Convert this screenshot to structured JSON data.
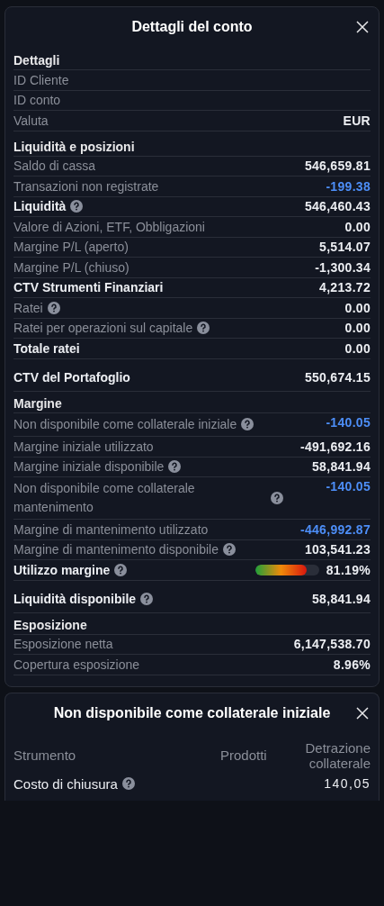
{
  "account_panel": {
    "title": "Dettagli del conto",
    "groups": [
      {
        "title": "Dettagli",
        "rows": [
          {
            "kind": "detail",
            "label": "ID Cliente",
            "help": false
          },
          {
            "kind": "detail",
            "label": "ID conto",
            "help": false
          },
          {
            "kind": "detail",
            "label": "Valuta",
            "value": "EUR",
            "help": false,
            "accent": false
          }
        ]
      },
      {
        "title": "Liquidità e posizioni",
        "rows": [
          {
            "kind": "detail",
            "label": "Saldo di cassa",
            "value": "546,659.81",
            "help": false,
            "accent": false
          },
          {
            "kind": "detail",
            "label": "Transazioni non registrate",
            "value": "-199.38",
            "help": false,
            "accent": true
          },
          {
            "kind": "total",
            "label": "Liquidità",
            "value": "546,460.43",
            "help": true,
            "accent": false
          },
          {
            "kind": "detail",
            "label": "Valore di Azioni, ETF, Obbligazioni",
            "value": "0.00",
            "help": false,
            "accent": false
          },
          {
            "kind": "detail",
            "label": "Margine P/L (aperto)",
            "value": "5,514.07",
            "help": false,
            "accent": false
          },
          {
            "kind": "detail",
            "label": "Margine P/L (chiuso)",
            "value": "-1,300.34",
            "help": false,
            "accent": false
          },
          {
            "kind": "total",
            "label": "CTV Strumenti Finanziari",
            "value": "4,213.72",
            "help": false,
            "accent": false
          },
          {
            "kind": "detail",
            "label": "Ratei",
            "value": "0.00",
            "help": true,
            "accent": false
          },
          {
            "kind": "detail",
            "label": "Ratei per operazioni sul capitale",
            "value": "0.00",
            "help": true,
            "accent": false
          },
          {
            "kind": "total",
            "label": "Totale ratei",
            "value": "0.00",
            "help": false,
            "accent": false
          }
        ]
      },
      {
        "rows": [
          {
            "kind": "total",
            "label": "CTV del Portafoglio",
            "value": "550,674.15",
            "help": false,
            "accent": false
          }
        ]
      },
      {
        "title": "Margine",
        "rows": [
          {
            "kind": "detail",
            "label": "Non disponibile come collaterale iniziale",
            "value": "-140.05",
            "help": true,
            "accent": true
          },
          {
            "kind": "detail",
            "label": "Margine iniziale utilizzato",
            "value": "-491,692.16",
            "help": false,
            "accent": false
          },
          {
            "kind": "detail",
            "label": "Margine iniziale disponibile",
            "value": "58,841.94",
            "help": true,
            "accent": false
          },
          {
            "kind": "detail",
            "label": "Non disponibile come collaterale mantenimento",
            "value": "-140.05",
            "help": true,
            "accent": true
          },
          {
            "kind": "detail",
            "label": "Margine di mantenimento utilizzato",
            "value": "-446,992.87",
            "help": false,
            "accent": true
          },
          {
            "kind": "detail",
            "label": "Margine di mantenimento disponibile",
            "value": "103,541.23",
            "help": true,
            "accent": false
          },
          {
            "kind": "meter",
            "label": "Utilizzo margine",
            "value": "81.19%",
            "level": 0.81,
            "help": true,
            "accent": false
          }
        ]
      },
      {
        "rows": [
          {
            "kind": "total",
            "label": "Liquidità disponibile",
            "value": "58,841.94",
            "help": true,
            "accent": false
          }
        ]
      },
      {
        "title": "Esposizione",
        "rows": [
          {
            "kind": "detail",
            "label": "Esposizione netta",
            "value": "6,147,538.70",
            "help": false,
            "accent": false
          },
          {
            "kind": "detail",
            "label": "Copertura esposizione",
            "value": "8.96%",
            "help": false,
            "accent": false
          }
        ]
      }
    ]
  },
  "collateral_panel": {
    "title": "Non disponibile come collaterale iniziale",
    "columns": [
      "Strumento",
      "Prodotti",
      "Detrazione collaterale"
    ],
    "rows": [
      {
        "cells": [
          "Costo di chiusura",
          "",
          "140,05"
        ],
        "help": true
      }
    ]
  }
}
